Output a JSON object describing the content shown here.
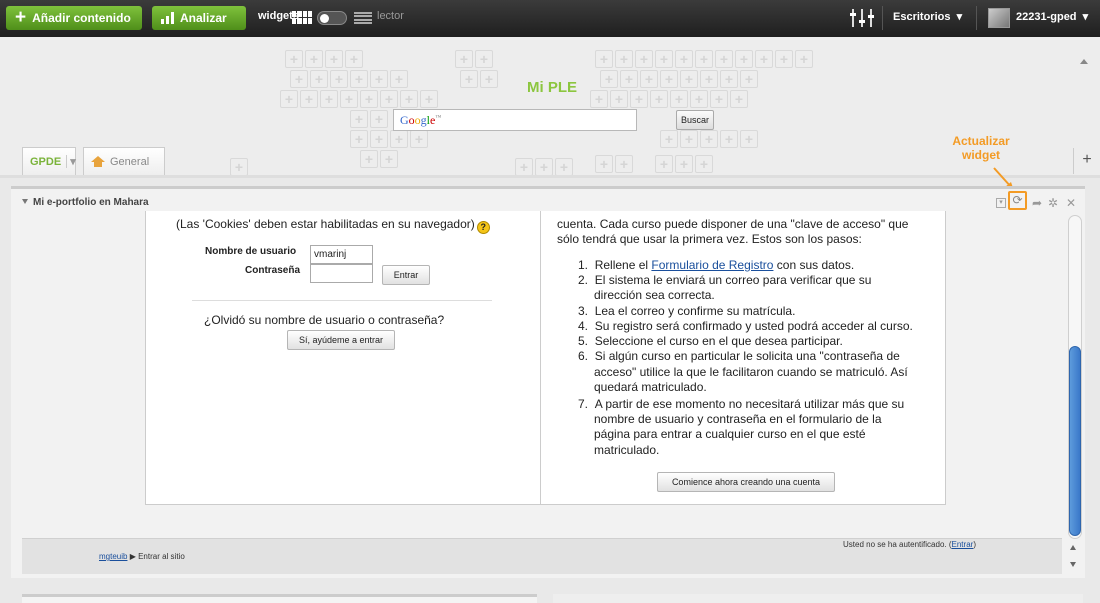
{
  "topbar": {
    "add_label": "Añadir contenido",
    "analyze_label": "Analizar",
    "widgets_label": "widgets",
    "lector_label": "lector",
    "desktops_label": "Escritorios",
    "user_label": "22231-gped"
  },
  "header": {
    "site_title": "Mi PLE",
    "google_g": "Google",
    "google_tm": "™",
    "search_value": "",
    "search_button": "Buscar"
  },
  "tabs": [
    {
      "label": "GPDE",
      "chevron": "▾"
    },
    {
      "label": "General"
    }
  ],
  "annotation": "Actualizar widget",
  "widget": {
    "title": "Mi e-portfolio en Mahara",
    "login": {
      "cookies_note": "(Las 'Cookies' deben estar habilitadas en su navegador)",
      "username_label": "Nombre de usuario",
      "username_value": "vmarinj",
      "password_label": "Contraseña",
      "password_value": "",
      "enter_button": "Entrar",
      "forgot_text": "¿Olvidó su nombre de usuario o contraseña?",
      "help_button": "Sí, ayúdeme a entrar"
    },
    "info": {
      "intro_line1": "cuenta. Cada curso puede disponer de una \"clave de acceso\" que",
      "intro_line2": "sólo tendrá que usar la primera vez. Estos son los pasos:",
      "step1_pre": "Rellene el",
      "step1_link": "Formulario de Registro",
      "step1_post": "con sus datos.",
      "step2": [
        "El sistema le enviará un correo para verificar que su",
        "dirección sea correcta."
      ],
      "step3": "Lea el correo y confirme su matrícula.",
      "step4": "Su registro será confirmado y usted podrá acceder al curso.",
      "step5": "Seleccione el curso en el que desea participar.",
      "step6": [
        "Si algún curso en particular le solicita una \"contraseña de",
        "acceso\" utilice la que le facilitaron cuando se matriculó. Así",
        "quedará matriculado."
      ],
      "step7": [
        "A partir de ese momento no necesitará utilizar más que su",
        "nombre de usuario y contraseña en el formulario de la",
        "página para entrar a cualquier curso en el que esté",
        "matriculado."
      ],
      "create_button": "Comience ahora creando una cuenta"
    },
    "footer": {
      "crumb_link": "mgteuib",
      "crumb_sep": "▶",
      "crumb_current": "Entrar al sitio",
      "auth_text": "Usted no se ha autentificado. (",
      "auth_link": "Entrar",
      "auth_close": ")"
    }
  },
  "colors": {
    "accent_green": "#8cc63f",
    "annotation_orange": "#f39b25",
    "link_blue": "#1a4f9c",
    "scroll_blue": "#3a78c9"
  },
  "icons": [
    "plus-icon",
    "bar-chart-icon",
    "grid-icon",
    "toggle-icon",
    "list-icon",
    "sliders-icon",
    "chevron-down-icon",
    "avatar",
    "house-icon",
    "help-icon",
    "minimize-icon",
    "refresh-icon",
    "share-arrow-icon",
    "gear-icon",
    "close-icon"
  ]
}
